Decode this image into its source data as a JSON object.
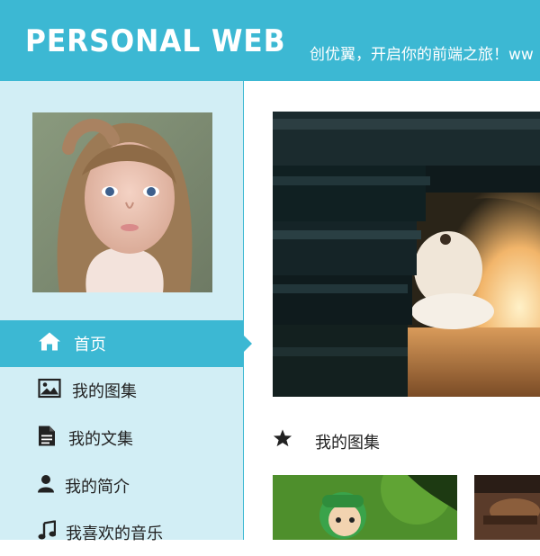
{
  "header": {
    "logo": "PERSONAL WEB",
    "slogan": "创优翼，开启你的前端之旅！ww"
  },
  "sidebar": {
    "avatar_alt": "avatar photo",
    "nav": [
      {
        "label": "首页",
        "icon": "home-icon",
        "active": true
      },
      {
        "label": "我的图集",
        "icon": "image-icon",
        "active": false
      },
      {
        "label": "我的文集",
        "icon": "document-icon",
        "active": false
      },
      {
        "label": "我的简介",
        "icon": "user-icon",
        "active": false
      },
      {
        "label": "我喜欢的音乐",
        "icon": "music-icon",
        "active": false
      }
    ]
  },
  "main": {
    "gallery_title": "我的图集"
  },
  "colors": {
    "header_bg": "#3cb8d3",
    "sidebar_bg": "#d2eef5",
    "active_nav_bg": "#3cb8d3"
  }
}
